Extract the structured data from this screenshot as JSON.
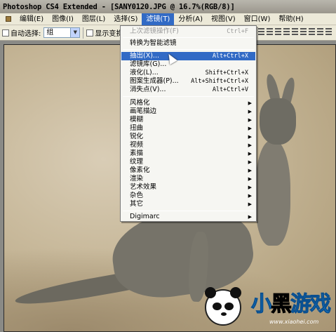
{
  "window": {
    "title": "Photoshop CS4 Extended - [SANY0120.JPG @ 16.7%(RGB/8)]"
  },
  "menubar": {
    "items": [
      {
        "label": "编辑(E)"
      },
      {
        "label": "图像(I)"
      },
      {
        "label": "图层(L)"
      },
      {
        "label": "选择(S)"
      },
      {
        "label": "滤镜(T)",
        "active": true
      },
      {
        "label": "分析(A)"
      },
      {
        "label": "视图(V)"
      },
      {
        "label": "窗口(W)"
      },
      {
        "label": "帮助(H)"
      }
    ]
  },
  "options": {
    "auto_select_label": "自动选择:",
    "auto_select_value": "组",
    "show_transform_label": "显示变换控"
  },
  "filter_menu": {
    "items": [
      {
        "label": "上次滤镜操作(F)",
        "shortcut": "Ctrl+F",
        "disabled": true
      },
      {
        "label": "转换为智能滤镜"
      },
      {
        "label": "抽出(X)...",
        "shortcut": "Alt+Ctrl+X",
        "highlighted": true
      },
      {
        "label": "滤镜库(G)..."
      },
      {
        "label": "液化(L)...",
        "shortcut": "Shift+Ctrl+X"
      },
      {
        "label": "图案生成器(P)...",
        "shortcut": "Alt+Shift+Ctrl+X"
      },
      {
        "label": "消失点(V)...",
        "shortcut": "Alt+Ctrl+V"
      },
      {
        "label": "风格化"
      },
      {
        "label": "画笔描边"
      },
      {
        "label": "模糊"
      },
      {
        "label": "扭曲"
      },
      {
        "label": "锐化"
      },
      {
        "label": "视频"
      },
      {
        "label": "素描"
      },
      {
        "label": "纹理"
      },
      {
        "label": "像素化"
      },
      {
        "label": "渲染"
      },
      {
        "label": "艺术效果"
      },
      {
        "label": "杂色"
      },
      {
        "label": "其它"
      },
      {
        "label": "Digimarc"
      }
    ],
    "submenu_arrow": "▶"
  },
  "watermark": {
    "logo_a": "小",
    "logo_b": "黑",
    "logo_c": "游戏",
    "url": "www.xiaohei.com"
  }
}
